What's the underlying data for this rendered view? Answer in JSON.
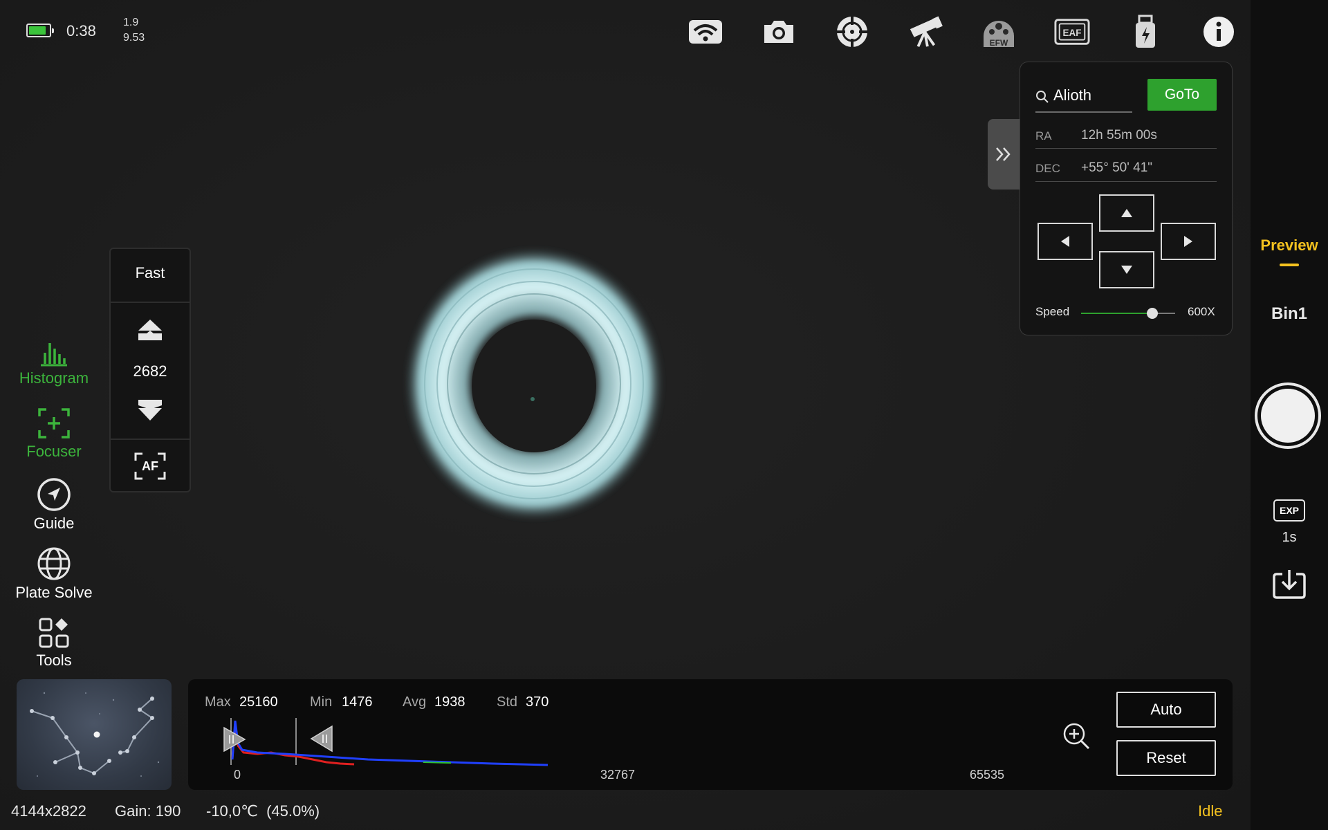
{
  "status": {
    "battery_time": "0:38",
    "value_top": "1.9",
    "value_bottom": "9.53"
  },
  "top_icons": [
    "wifi-icon",
    "camera-icon",
    "guide-target-icon",
    "telescope-icon",
    "efw-icon",
    "eaf-icon",
    "usb-storage-icon",
    "info-icon"
  ],
  "top_icon_labels": {
    "efw": "EFW",
    "eaf": "EAF"
  },
  "left_menu": [
    {
      "id": "histogram",
      "label": "Histogram",
      "icon": "histogram-icon",
      "active": true
    },
    {
      "id": "focuser",
      "label": "Focuser",
      "icon": "focuser-icon",
      "active": true
    },
    {
      "id": "guide",
      "label": "Guide",
      "icon": "guide-icon",
      "active": false
    },
    {
      "id": "plate-solve",
      "label": "Plate Solve",
      "icon": "globe-icon",
      "active": false
    },
    {
      "id": "tools",
      "label": "Tools",
      "icon": "tools-icon",
      "active": false
    }
  ],
  "focuser": {
    "mode": "Fast",
    "position": "2682",
    "af_label": "AF"
  },
  "goto": {
    "search_value": "Alioth",
    "goto_label": "GoTo",
    "ra_label": "RA",
    "ra_value": "12h 55m 00s",
    "dec_label": "DEC",
    "dec_value": "+55° 50' 41\"",
    "speed_label": "Speed",
    "speed_value": "600X",
    "speed_level": 0.76
  },
  "right_bar": {
    "mode": "Preview",
    "bin": "Bin1",
    "exp_icon_label": "EXP",
    "exp_value": "1s"
  },
  "histogram": {
    "max_label": "Max",
    "max_value": "25160",
    "min_label": "Min",
    "min_value": "1476",
    "avg_label": "Avg",
    "avg_value": "1938",
    "std_label": "Std",
    "std_value": "370",
    "axis_min": "0",
    "axis_mid": "32767",
    "axis_max": "65535",
    "auto_label": "Auto",
    "reset_label": "Reset"
  },
  "bottom": {
    "resolution": "4144x2822",
    "gain": "Gain: 190",
    "temperature": "-10,0℃  (45.0%)",
    "state": "Idle"
  },
  "colors": {
    "accent_green": "#2ea12e",
    "active_green": "#3cb43c",
    "preview_yellow": "#f4c21f",
    "star_cyan": "#cfeef0"
  }
}
